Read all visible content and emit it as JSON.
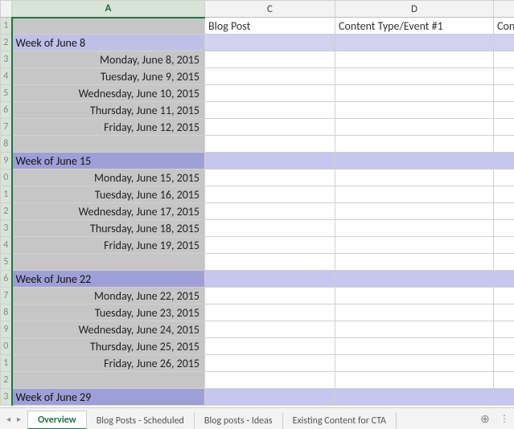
{
  "column_headers": {
    "A": "A",
    "C": "C",
    "D": "D"
  },
  "header_row": {
    "blog_post": "Blog Post",
    "content_type": "Content Type/Event #1",
    "cont_partial": "Cont"
  },
  "row_numbers": [
    "1",
    "2",
    "3",
    "4",
    "5",
    "6",
    "7",
    "8",
    "9",
    "0",
    "1",
    "2",
    "3",
    "4",
    "5",
    "6",
    "7",
    "8",
    "9",
    "0",
    "1",
    "2",
    "3"
  ],
  "weeks": [
    {
      "label": "Week of June 8",
      "days": [
        "Monday, June 8, 2015",
        "Tuesday, June 9, 2015",
        "Wednesday, June 10, 2015",
        "Thursday, June 11, 2015",
        "Friday, June 12, 2015"
      ]
    },
    {
      "label": "Week of June 15",
      "days": [
        "Monday, June 15, 2015",
        "Tuesday, June 16, 2015",
        "Wednesday, June 17, 2015",
        "Thursday, June 18, 2015",
        "Friday, June 19, 2015"
      ]
    },
    {
      "label": "Week of June 22",
      "days": [
        "Monday, June 22, 2015",
        "Tuesday, June 23, 2015",
        "Wednesday, June 24, 2015",
        "Thursday, June 25, 2015",
        "Friday, June 26, 2015"
      ]
    },
    {
      "label": "Week of June 29",
      "days": []
    }
  ],
  "tabs": {
    "active": "Overview",
    "others": [
      "Blog Posts - Scheduled",
      "Blog posts - Ideas",
      "Existing Content for CTA"
    ]
  },
  "icons": {
    "nav_left": "◂",
    "nav_right": "▸",
    "add": "⊕",
    "more": "⋮"
  }
}
